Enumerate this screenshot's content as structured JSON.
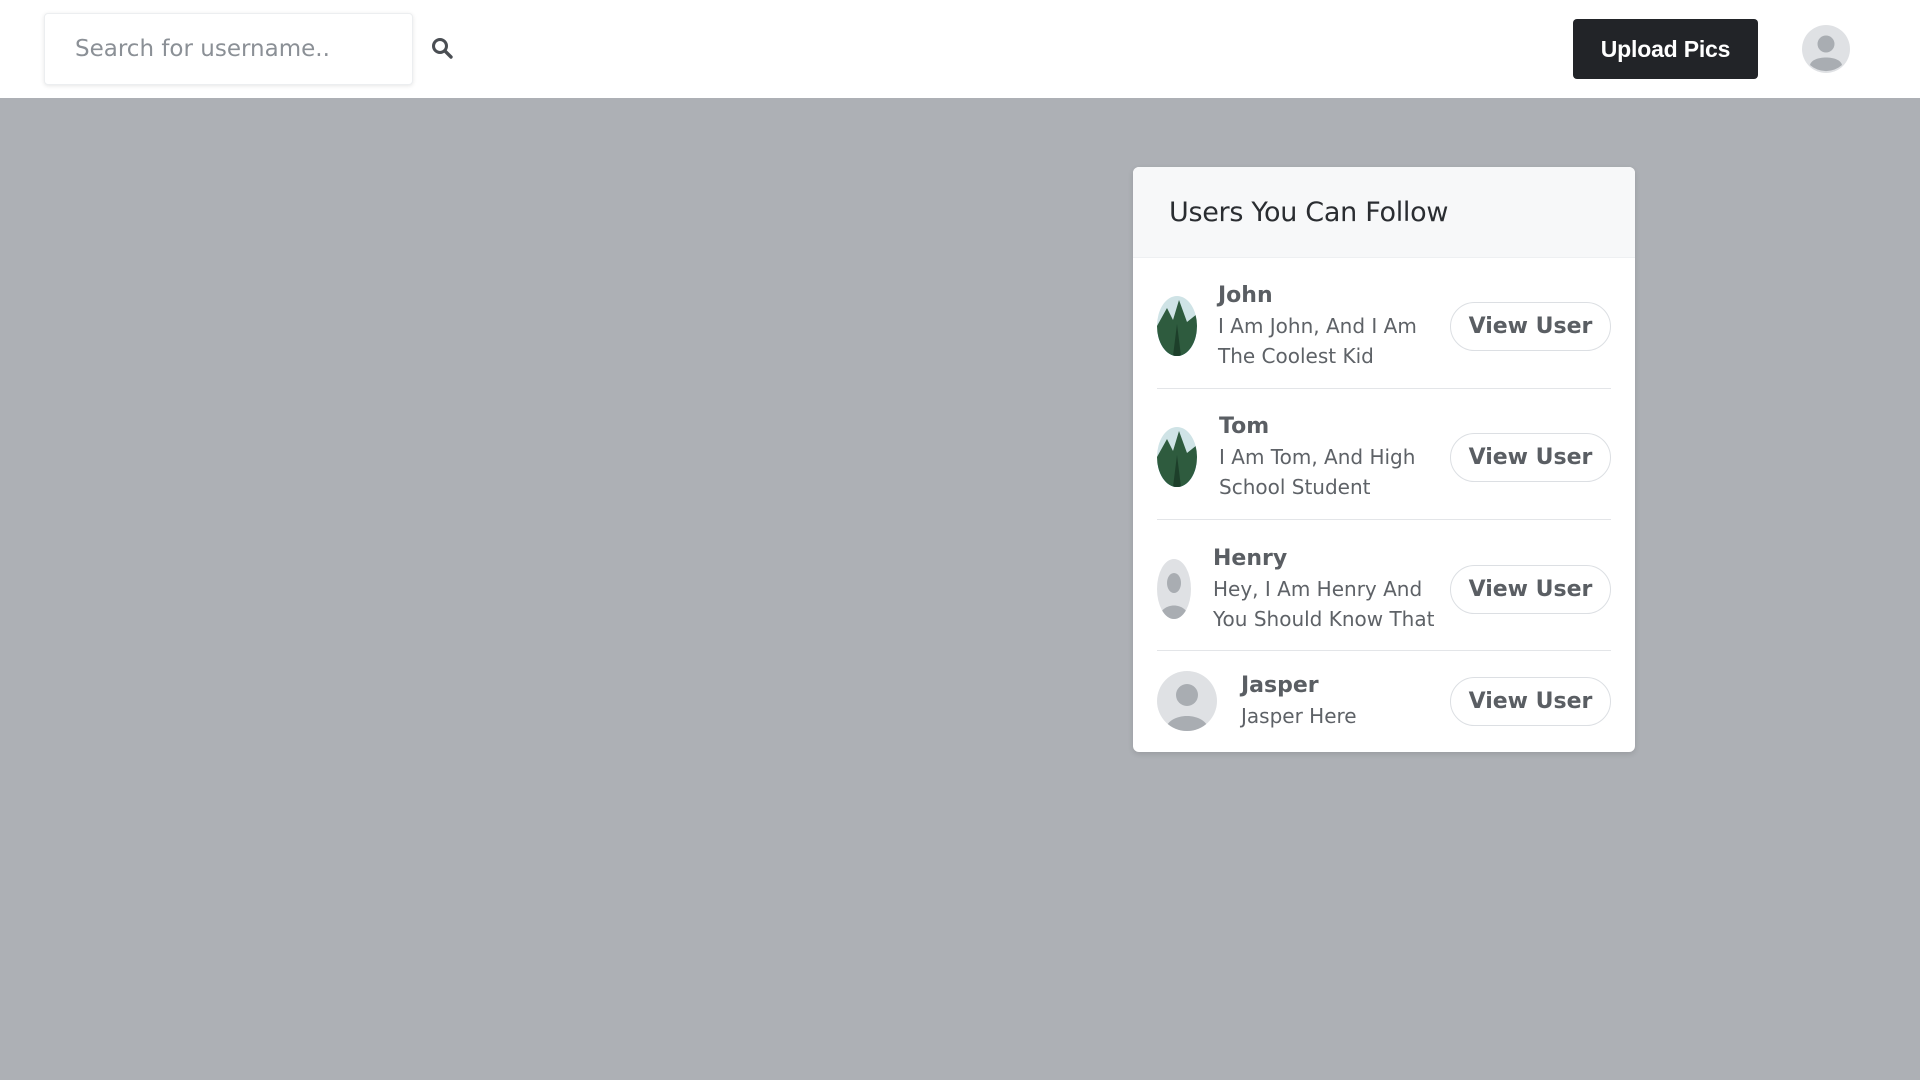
{
  "search": {
    "placeholder": "Search for username.."
  },
  "header": {
    "upload_label": "Upload Pics"
  },
  "suggestions": {
    "title": "Users You Can Follow",
    "users": [
      {
        "name": "John",
        "bio_line1": "I Am John, And I Am",
        "bio_line2": "The Coolest Kid",
        "avatar": "landscape-photo",
        "button": "View User"
      },
      {
        "name": "Tom",
        "bio_line1": "I Am Tom, And High",
        "bio_line2": "School Student",
        "avatar": "landscape-photo",
        "button": "View User"
      },
      {
        "name": "Henry",
        "bio_line1": "Hey, I Am Henry And",
        "bio_line2": "You Should Know That",
        "avatar": "default-user",
        "button": "View User"
      },
      {
        "name": "Jasper",
        "bio_line1": "Jasper Here",
        "bio_line2": "",
        "avatar": "default-user",
        "button": "View User"
      }
    ]
  },
  "colors": {
    "background": "#adb0b5",
    "topbar": "#ffffff",
    "upload_button": "#222428",
    "card_header": "#f7f8f9"
  }
}
